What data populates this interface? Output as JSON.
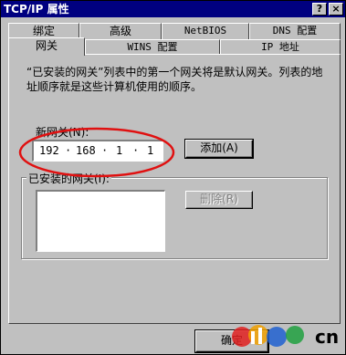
{
  "window": {
    "title": "TCP/IP 属性",
    "help_label": "?",
    "close_label": "×"
  },
  "tabs": {
    "back_row": [
      {
        "label": "绑定"
      },
      {
        "label": "高级"
      },
      {
        "label": "NetBIOS"
      },
      {
        "label": "DNS 配置"
      }
    ],
    "front_row": [
      {
        "label": "网关",
        "active": true
      },
      {
        "label": "WINS 配置"
      },
      {
        "label": "IP 地址"
      }
    ]
  },
  "gateway": {
    "description": "“已安装的网关”列表中的第一个网关将是默认网关。列表的地址顺序就是这些计算机使用的顺序。",
    "new_gateway_label": "新网关(N):",
    "ip_segments": [
      "192",
      "168",
      "1",
      "1"
    ],
    "add_button": "添加(A)",
    "installed_label": "已安装的网关(I):",
    "remove_button": "删除(R)",
    "installed_items": []
  },
  "footer": {
    "ok_button": "确定"
  },
  "watermark": {
    "text": "cn",
    "colors": [
      "#e02020",
      "#f0a000",
      "#2060d0",
      "#20a040"
    ]
  },
  "annotation": {
    "color": "#e01010"
  }
}
